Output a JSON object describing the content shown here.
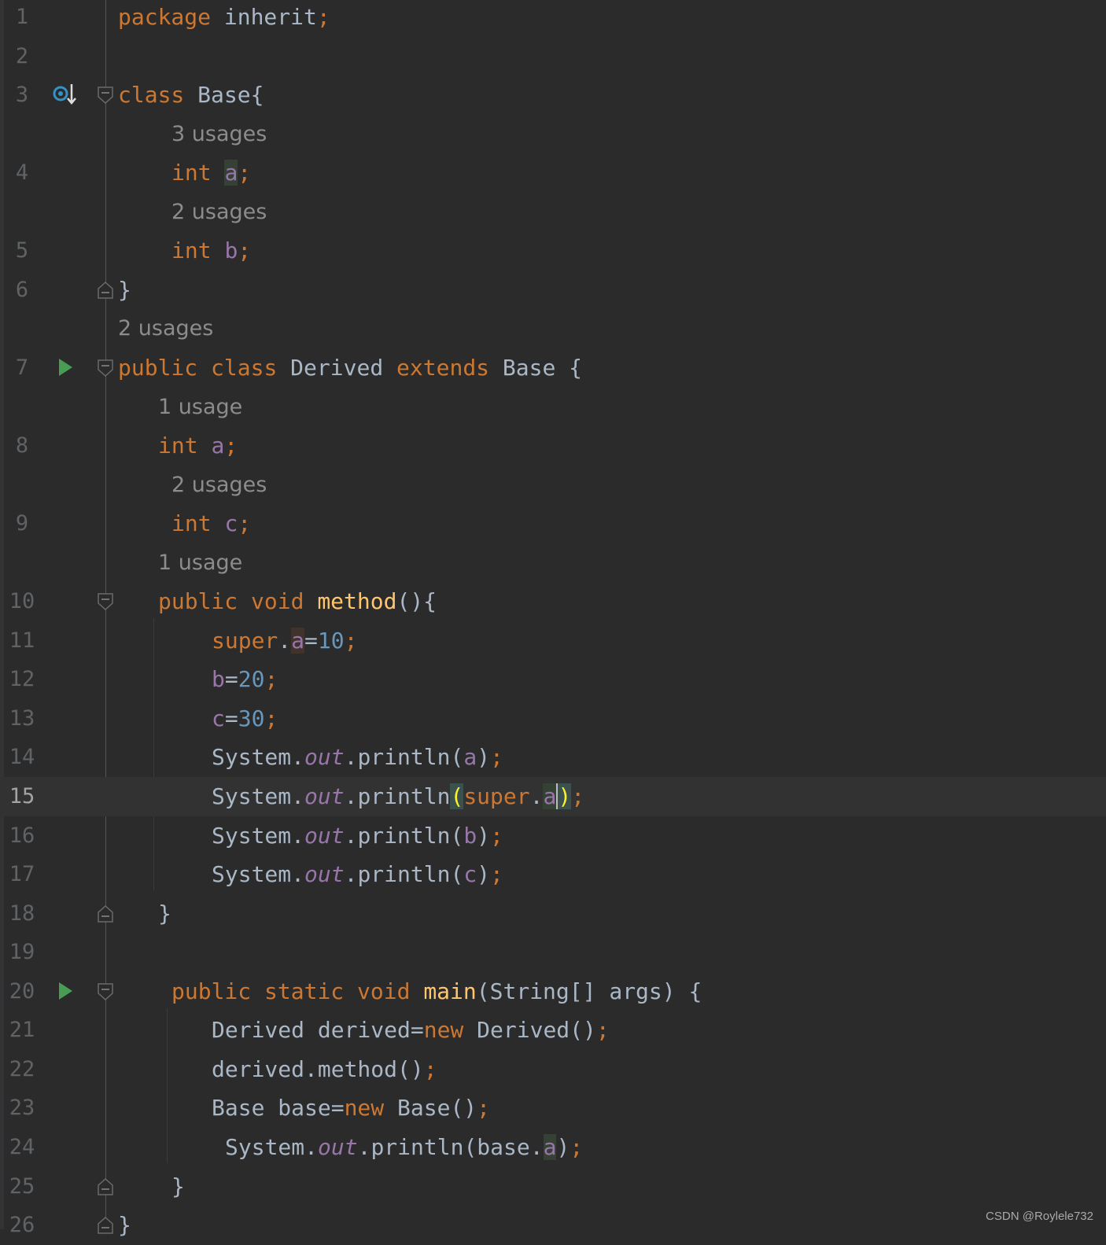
{
  "editor": {
    "lines": [
      {
        "n": "1",
        "tokens": [
          {
            "t": "package ",
            "c": "kw"
          },
          {
            "t": "inherit",
            "c": ""
          },
          {
            "t": ";",
            "c": "kw"
          }
        ]
      },
      {
        "n": "2",
        "tokens": []
      },
      {
        "n": "3",
        "icon": "implemented-class-icon",
        "fold": "open",
        "tokens": [
          {
            "t": "class ",
            "c": "kw"
          },
          {
            "t": "Base{",
            "c": ""
          }
        ]
      },
      {
        "n": "",
        "hint": "3 usages"
      },
      {
        "n": "4",
        "tokens": [
          {
            "t": "int ",
            "c": "kw"
          },
          {
            "t": "a",
            "c": "fld hl-use"
          },
          {
            "t": ";",
            "c": "kw"
          }
        ]
      },
      {
        "n": "",
        "hint": "2 usages"
      },
      {
        "n": "5",
        "tokens": [
          {
            "t": "int ",
            "c": "kw"
          },
          {
            "t": "b",
            "c": "fld"
          },
          {
            "t": ";",
            "c": "kw"
          }
        ]
      },
      {
        "n": "6",
        "fold": "close",
        "tokens": [
          {
            "t": "}",
            "c": ""
          }
        ]
      },
      {
        "n": "",
        "hint": "2 usages"
      },
      {
        "n": "7",
        "icon": "run-icon",
        "fold": "open",
        "tokens": [
          {
            "t": "public ",
            "c": "kw"
          },
          {
            "t": "class ",
            "c": "kw"
          },
          {
            "t": "Derived ",
            "c": ""
          },
          {
            "t": "extends ",
            "c": "kw"
          },
          {
            "t": "Base {",
            "c": ""
          }
        ]
      },
      {
        "n": "",
        "hint": "1 usage"
      },
      {
        "n": "8",
        "tokens": [
          {
            "t": "int ",
            "c": "kw"
          },
          {
            "t": "a",
            "c": "fld"
          },
          {
            "t": ";",
            "c": "kw"
          }
        ]
      },
      {
        "n": "",
        "hint": "2 usages"
      },
      {
        "n": "9",
        "tokens": [
          {
            "t": "int ",
            "c": "kw"
          },
          {
            "t": "c",
            "c": "fld"
          },
          {
            "t": ";",
            "c": "kw"
          }
        ]
      },
      {
        "n": "",
        "hint": "1 usage"
      },
      {
        "n": "10",
        "fold": "open",
        "tokens": [
          {
            "t": "public ",
            "c": "kw"
          },
          {
            "t": "void ",
            "c": "kw"
          },
          {
            "t": "method",
            "c": "fn"
          },
          {
            "t": "(){",
            "c": ""
          }
        ]
      },
      {
        "n": "11",
        "tokens": [
          {
            "t": "super",
            "c": "kw"
          },
          {
            "t": ".",
            "c": ""
          },
          {
            "t": "a",
            "c": "fld hl-write"
          },
          {
            "t": "=",
            "c": ""
          },
          {
            "t": "10",
            "c": "num"
          },
          {
            "t": ";",
            "c": "kw"
          }
        ]
      },
      {
        "n": "12",
        "tokens": [
          {
            "t": "b",
            "c": "fld"
          },
          {
            "t": "=",
            "c": ""
          },
          {
            "t": "20",
            "c": "num"
          },
          {
            "t": ";",
            "c": "kw"
          }
        ]
      },
      {
        "n": "13",
        "tokens": [
          {
            "t": "c",
            "c": "fld"
          },
          {
            "t": "=",
            "c": ""
          },
          {
            "t": "30",
            "c": "num"
          },
          {
            "t": ";",
            "c": "kw"
          }
        ]
      },
      {
        "n": "14",
        "tokens": [
          {
            "t": "System.",
            "c": ""
          },
          {
            "t": "out",
            "c": "sta"
          },
          {
            "t": ".println(",
            "c": ""
          },
          {
            "t": "a",
            "c": "fld"
          },
          {
            "t": ")",
            "c": ""
          },
          {
            "t": ";",
            "c": "kw"
          }
        ]
      },
      {
        "n": "15",
        "current": true,
        "tokens": [
          {
            "t": "System.",
            "c": ""
          },
          {
            "t": "out",
            "c": "sta"
          },
          {
            "t": ".println",
            "c": ""
          },
          {
            "t": "(",
            "c": "hl-brace"
          },
          {
            "t": "super",
            "c": "kw"
          },
          {
            "t": ".",
            "c": ""
          },
          {
            "t": "a",
            "c": "fld hl-use"
          },
          {
            "t": ")",
            "c": "hl-brace caret"
          },
          {
            "t": ";",
            "c": "kw"
          }
        ]
      },
      {
        "n": "16",
        "tokens": [
          {
            "t": "System.",
            "c": ""
          },
          {
            "t": "out",
            "c": "sta"
          },
          {
            "t": ".println(",
            "c": ""
          },
          {
            "t": "b",
            "c": "fld"
          },
          {
            "t": ")",
            "c": ""
          },
          {
            "t": ";",
            "c": "kw"
          }
        ]
      },
      {
        "n": "17",
        "tokens": [
          {
            "t": "System.",
            "c": ""
          },
          {
            "t": "out",
            "c": "sta"
          },
          {
            "t": ".println(",
            "c": ""
          },
          {
            "t": "c",
            "c": "fld"
          },
          {
            "t": ")",
            "c": ""
          },
          {
            "t": ";",
            "c": "kw"
          }
        ]
      },
      {
        "n": "18",
        "fold": "close",
        "tokens": [
          {
            "t": "}",
            "c": ""
          }
        ]
      },
      {
        "n": "19",
        "tokens": []
      },
      {
        "n": "20",
        "icon": "run-icon",
        "fold": "open",
        "tokens": [
          {
            "t": "public ",
            "c": "kw"
          },
          {
            "t": "static ",
            "c": "kw"
          },
          {
            "t": "void ",
            "c": "kw"
          },
          {
            "t": "main",
            "c": "fn"
          },
          {
            "t": "(String[] args) {",
            "c": ""
          }
        ]
      },
      {
        "n": "21",
        "tokens": [
          {
            "t": "Derived derived=",
            "c": ""
          },
          {
            "t": "new ",
            "c": "kw"
          },
          {
            "t": "Derived()",
            "c": ""
          },
          {
            "t": ";",
            "c": "kw"
          }
        ]
      },
      {
        "n": "22",
        "tokens": [
          {
            "t": "derived.method()",
            "c": ""
          },
          {
            "t": ";",
            "c": "kw"
          }
        ]
      },
      {
        "n": "23",
        "tokens": [
          {
            "t": "Base base=",
            "c": ""
          },
          {
            "t": "new ",
            "c": "kw"
          },
          {
            "t": "Base()",
            "c": ""
          },
          {
            "t": ";",
            "c": "kw"
          }
        ]
      },
      {
        "n": "24",
        "tokens": [
          {
            "t": "System.",
            "c": ""
          },
          {
            "t": "out",
            "c": "sta"
          },
          {
            "t": ".println(base.",
            "c": ""
          },
          {
            "t": "a",
            "c": "fld hl-use"
          },
          {
            "t": ")",
            "c": ""
          },
          {
            "t": ";",
            "c": "kw"
          }
        ]
      },
      {
        "n": "25",
        "fold": "close",
        "tokens": [
          {
            "t": "}",
            "c": ""
          }
        ]
      },
      {
        "n": "26",
        "fold": "close",
        "tokens": [
          {
            "t": "}",
            "c": ""
          }
        ]
      }
    ]
  },
  "watermark": "CSDN @Roylele732"
}
